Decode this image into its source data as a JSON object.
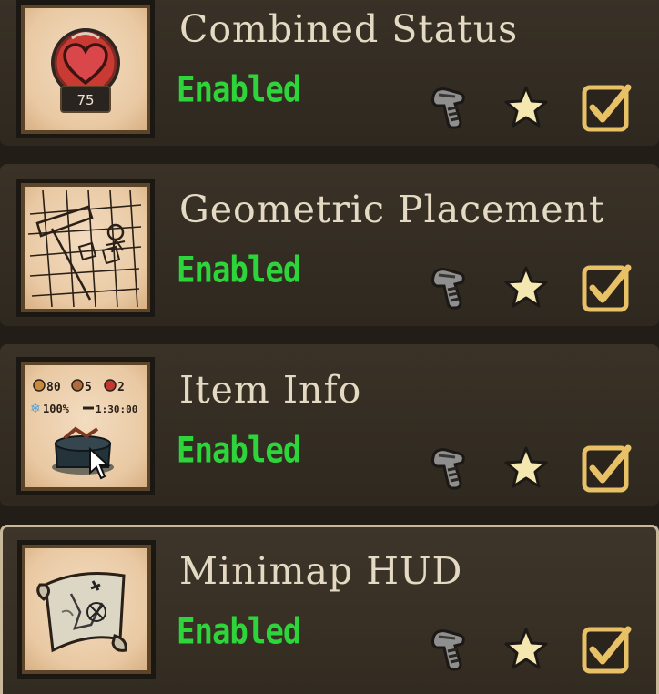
{
  "mods": [
    {
      "title": "Combined Status",
      "status": "Enabled",
      "icon": "heart-badge-icon",
      "badge_value": "75",
      "selected": false,
      "enabled": true
    },
    {
      "title": "Geometric Placement",
      "status": "Enabled",
      "icon": "grid-sketch-icon",
      "selected": false,
      "enabled": true
    },
    {
      "title": "Item Info",
      "status": "Enabled",
      "icon": "item-info-preview-icon",
      "info_stats": [
        "80",
        "5",
        "2"
      ],
      "info_extra": [
        "100%",
        "1:30:00"
      ],
      "selected": false,
      "enabled": true
    },
    {
      "title": "Minimap HUD",
      "status": "Enabled",
      "icon": "scroll-map-icon",
      "selected": true,
      "enabled": true
    }
  ],
  "actions": {
    "configure": "wrench-icon",
    "favorite": "star-icon",
    "toggle": "checkbox-icon"
  },
  "colors": {
    "status_enabled": "#2ed53a",
    "title_text": "#e4dac4",
    "panel_bg": "#362e24",
    "star_fill": "#f5e7b0",
    "checkbox_gold": "#e8c066"
  }
}
